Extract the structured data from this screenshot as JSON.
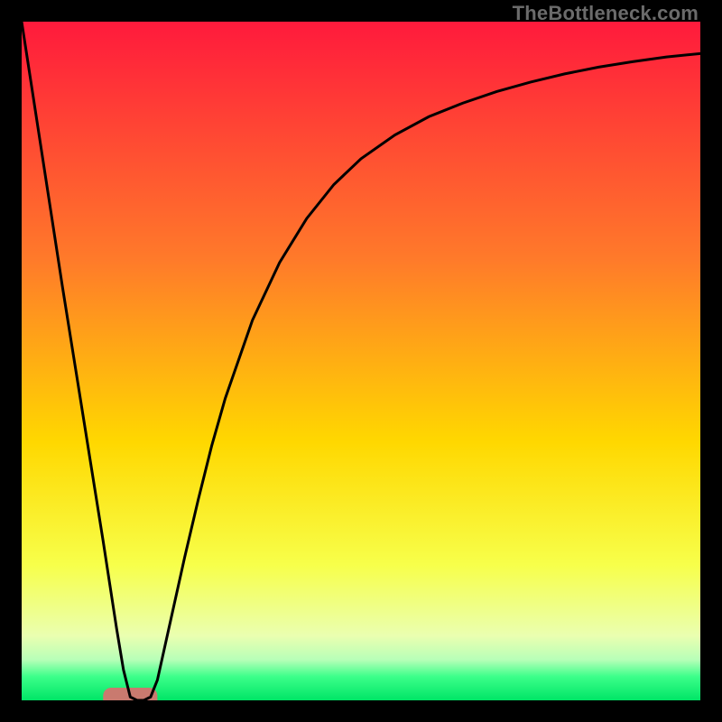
{
  "watermark": "TheBottleneck.com",
  "chart_data": {
    "type": "line",
    "title": "",
    "xlabel": "",
    "ylabel": "",
    "xlim": [
      0,
      100
    ],
    "ylim": [
      0,
      100
    ],
    "grid": false,
    "legend": false,
    "gradient_stops": [
      {
        "offset": 0.0,
        "color": "#ff1a3c"
      },
      {
        "offset": 0.35,
        "color": "#ff7a2a"
      },
      {
        "offset": 0.62,
        "color": "#ffd800"
      },
      {
        "offset": 0.8,
        "color": "#f7ff4a"
      },
      {
        "offset": 0.905,
        "color": "#eaffb0"
      },
      {
        "offset": 0.94,
        "color": "#b8ffb8"
      },
      {
        "offset": 0.965,
        "color": "#3cff8a"
      },
      {
        "offset": 1.0,
        "color": "#00e566"
      }
    ],
    "optimum_band": {
      "x_start": 12.0,
      "x_end": 20.0,
      "y": 1.0,
      "color": "#c97a6f"
    },
    "x": [
      0,
      2,
      4,
      6,
      8,
      10,
      12,
      13,
      14,
      15,
      16,
      17,
      18,
      19,
      20,
      22,
      24,
      26,
      28,
      30,
      34,
      38,
      42,
      46,
      50,
      55,
      60,
      65,
      70,
      75,
      80,
      85,
      90,
      95,
      100
    ],
    "values": [
      100,
      87.0,
      74.0,
      61.0,
      48.5,
      36.0,
      23.5,
      17.0,
      10.5,
      4.5,
      0.5,
      0.0,
      0.0,
      0.5,
      3.0,
      12.0,
      21.0,
      29.5,
      37.5,
      44.5,
      56.0,
      64.5,
      71.0,
      76.0,
      79.8,
      83.3,
      86.0,
      88.0,
      89.7,
      91.1,
      92.3,
      93.3,
      94.1,
      94.8,
      95.3
    ],
    "series_annotation": "Bottleneck curve — dips to ~0 near x≈16–18 (optimum) then asymptotically approaches ~95 as x→100."
  }
}
